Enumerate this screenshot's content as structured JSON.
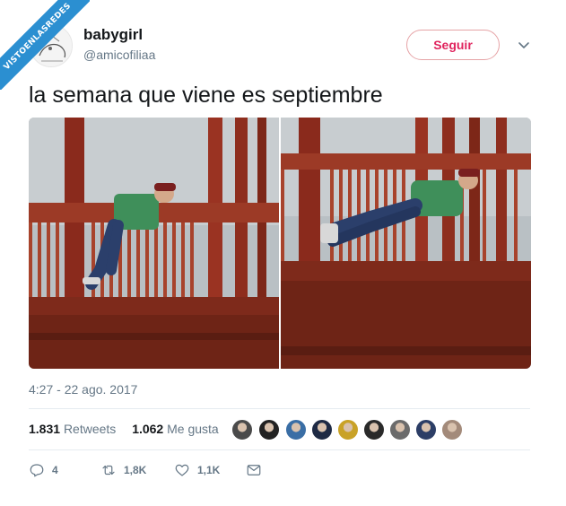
{
  "watermark": "VISTOENLASREDES",
  "user": {
    "name": "babygirl",
    "handle": "@amicofiliaa"
  },
  "follow_button": "Seguir",
  "tweet": {
    "text": "la semana que viene es septiembre",
    "timestamp": "4:27 - 22 ago. 2017"
  },
  "stats": {
    "retweets_count": "1.831",
    "retweets_label": "Retweets",
    "likes_count": "1.062",
    "likes_label": "Me gusta"
  },
  "likers": [
    "#4a4a4a",
    "#222222",
    "#3a6ea5",
    "#1e2a44",
    "#c9a227",
    "#2a2a2a",
    "#6b6b6b",
    "#2c3e66",
    "#a38a7a"
  ],
  "actions": {
    "reply_count": "4",
    "retweet_count": "1,8K",
    "like_count": "1,1K"
  },
  "colors": {
    "accent": "#e0245e",
    "secondary_text": "#657786",
    "watermark": "#2b8fd1"
  }
}
